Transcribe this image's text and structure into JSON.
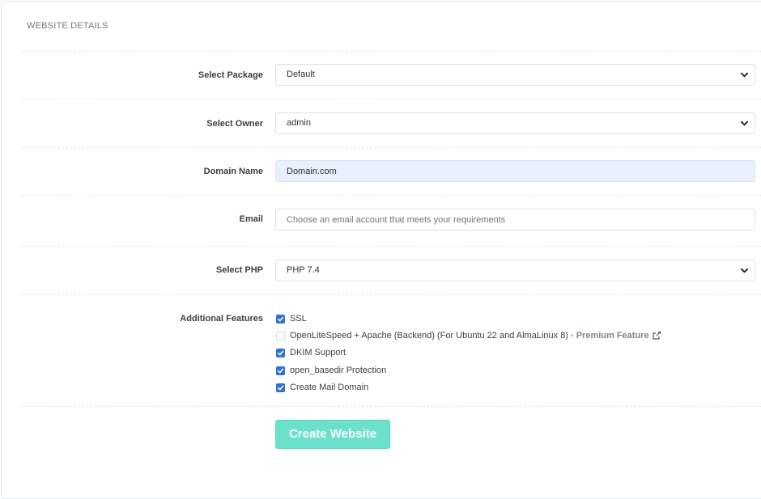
{
  "section": {
    "title": "WEBSITE DETAILS"
  },
  "form": {
    "package": {
      "label": "Select Package",
      "value": "Default"
    },
    "owner": {
      "label": "Select Owner",
      "value": "admin"
    },
    "domain": {
      "label": "Domain Name",
      "value": "Domain.com"
    },
    "email": {
      "label": "Email",
      "placeholder": "Choose an email account that meets your requirements"
    },
    "php": {
      "label": "Select PHP",
      "value": "PHP 7.4"
    },
    "features": {
      "label": "Additional Features",
      "items": [
        {
          "label": "SSL",
          "checked": true
        },
        {
          "label": "OpenLiteSpeed + Apache (Backend) (For Ubuntu 22 and AlmaLinux 8) -",
          "premium_label": "Premium Feature",
          "checked": false
        },
        {
          "label": "DKIM Support",
          "checked": true
        },
        {
          "label": "open_basedir Protection",
          "checked": true
        },
        {
          "label": "Create Mail Domain",
          "checked": true
        }
      ]
    },
    "submit_label": "Create Website"
  },
  "colors": {
    "checkbox_accent": "#2f6fd6",
    "button_bg": "#6be1cc",
    "filled_input_bg": "#e8f0fe"
  }
}
